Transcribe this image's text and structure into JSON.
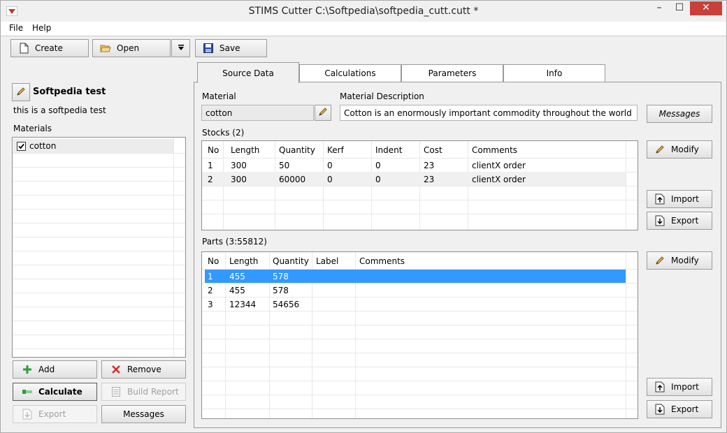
{
  "window": {
    "title": "STIMS Cutter  C:\\Softpedia\\softpedia_cutt.cutt *",
    "minimize": "–",
    "maximize": "☐",
    "close": "✕"
  },
  "menu": [
    "File",
    "Help"
  ],
  "toolbar": {
    "create": "Create",
    "open": "Open",
    "save": "Save"
  },
  "project": {
    "name": "Softpedia test",
    "description": "this is a softpedia test",
    "materials_label": "Materials"
  },
  "materials": [
    {
      "name": "cotton",
      "checked": true
    }
  ],
  "left_buttons": {
    "add": "Add",
    "remove": "Remove",
    "calculate": "Calculate",
    "build_report": "Build Report",
    "export": "Export",
    "messages": "Messages"
  },
  "tabs": [
    "Source Data",
    "Calculations",
    "Parameters",
    "Info"
  ],
  "source": {
    "material_label": "Material",
    "material_value": "cotton",
    "desc_label": "Material Description",
    "desc_value": "Cotton is an enormously important commodity throughout the world",
    "messages_button": "Messages",
    "stocks_label": "Stocks (2)",
    "stocks_columns": [
      "No",
      "Length",
      "Quantity",
      "Kerf",
      "Indent",
      "Cost",
      "Comments"
    ],
    "stocks_rows": [
      [
        "1",
        "300",
        "50",
        "0",
        "0",
        "23",
        "clientX order"
      ],
      [
        "2",
        "300",
        "60000",
        "0",
        "0",
        "23",
        "clientX order"
      ]
    ],
    "parts_label": "Parts (3:55812)",
    "parts_columns": [
      "No",
      "Length",
      "Quantity",
      "Label",
      "Comments"
    ],
    "parts_rows": [
      [
        "1",
        "455",
        "578",
        "",
        ""
      ],
      [
        "2",
        "455",
        "578",
        "",
        ""
      ],
      [
        "3",
        "12344",
        "54656",
        "",
        ""
      ]
    ],
    "modify": "Modify",
    "import": "Import",
    "export": "Export"
  },
  "colors": {
    "selection": "#3399ff",
    "close": "#c7413a"
  }
}
